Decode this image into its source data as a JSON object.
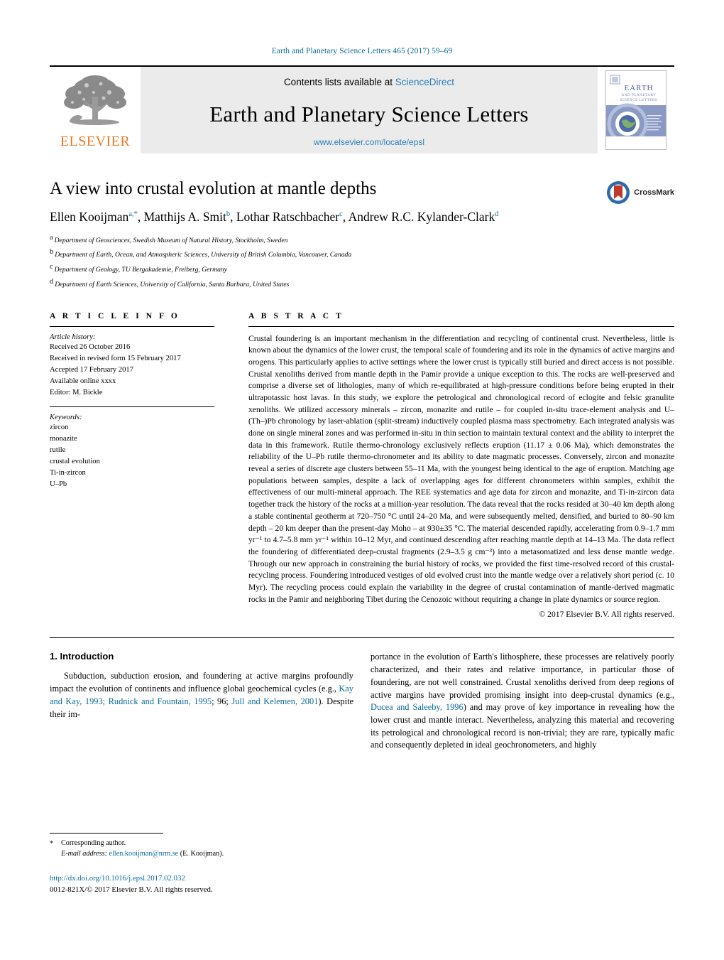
{
  "running_head": "Earth and Planetary Science Letters 465 (2017) 59–69",
  "masthead": {
    "publisher_name": "ELSEVIER",
    "contents_prefix": "Contents lists available at ",
    "contents_link": "ScienceDirect",
    "journal_title": "Earth and Planetary Science Letters",
    "journal_url": "www.elsevier.com/locate/epsl",
    "cover_title_line1": "EARTH",
    "cover_title_line2": "AND PLANETARY",
    "cover_title_line3": "SCIENCE LETTERS"
  },
  "article": {
    "title": "A view into crustal evolution at mantle depths",
    "crossmark_label": "CrossMark",
    "authors": [
      {
        "name": "Ellen Kooijman",
        "marks": "a,*"
      },
      {
        "name": "Matthijs A. Smit",
        "marks": "b"
      },
      {
        "name": "Lothar Ratschbacher",
        "marks": "c"
      },
      {
        "name": "Andrew R.C. Kylander-Clark",
        "marks": "d"
      }
    ],
    "affiliations": [
      {
        "mark": "a",
        "text": "Department of Geosciences, Swedish Museum of Natural History, Stockholm, Sweden"
      },
      {
        "mark": "b",
        "text": "Department of Earth, Ocean, and Atmospheric Sciences, University of British Columbia, Vancouver, Canada"
      },
      {
        "mark": "c",
        "text": "Department of Geology, TU Bergakademie, Freiberg, Germany"
      },
      {
        "mark": "d",
        "text": "Department of Earth Sciences, University of California, Santa Barbara, United States"
      }
    ]
  },
  "article_info": {
    "heading": "A R T I C L E   I N F O",
    "history_label": "Article history:",
    "history": [
      "Received 26 October 2016",
      "Received in revised form 15 February 2017",
      "Accepted 17 February 2017",
      "Available online xxxx",
      "Editor: M. Bickle"
    ],
    "keywords_label": "Keywords:",
    "keywords": [
      "zircon",
      "monazite",
      "rutile",
      "crustal evolution",
      "Ti-in-zircon",
      "U–Pb"
    ]
  },
  "abstract": {
    "heading": "A B S T R A C T",
    "text": "Crustal foundering is an important mechanism in the differentiation and recycling of continental crust. Nevertheless, little is known about the dynamics of the lower crust, the temporal scale of foundering and its role in the dynamics of active margins and orogens. This particularly applies to active settings where the lower crust is typically still buried and direct access is not possible. Crustal xenoliths derived from mantle depth in the Pamir provide a unique exception to this. The rocks are well-preserved and comprise a diverse set of lithologies, many of which re-equilibrated at high-pressure conditions before being erupted in their ultrapotassic host lavas. In this study, we explore the petrological and chronological record of eclogite and felsic granulite xenoliths. We utilized accessory minerals – zircon, monazite and rutile – for coupled in-situ trace-element analysis and U–(Th–)Pb chronology by laser-ablation (split-stream) inductively coupled plasma mass spectrometry. Each integrated analysis was done on single mineral zones and was performed in-situ in thin section to maintain textural context and the ability to interpret the data in this framework. Rutile thermo-chronology exclusively reflects eruption (11.17 ± 0.06 Ma), which demonstrates the reliability of the U–Pb rutile thermo-chronometer and its ability to date magmatic processes. Conversely, zircon and monazite reveal a series of discrete age clusters between 55–11 Ma, with the youngest being identical to the age of eruption. Matching age populations between samples, despite a lack of overlapping ages for different chronometers within samples, exhibit the effectiveness of our multi-mineral approach. The REE systematics and age data for zircon and monazite, and Ti-in-zircon data together track the history of the rocks at a million-year resolution. The data reveal that the rocks resided at 30–40 km depth along a stable continental geotherm at 720–750 °C until 24–20 Ma, and were subsequently melted, densified, and buried to 80–90 km depth – 20 km deeper than the present-day Moho – at 930±35 °C. The material descended rapidly, accelerating from 0.9–1.7 mm yr⁻¹ to 4.7–5.8 mm yr⁻¹ within 10–12 Myr, and continued descending after reaching mantle depth at 14–13 Ma. The data reflect the foundering of differentiated deep-crustal fragments (2.9–3.5 g cm⁻³) into a metasomatized and less dense mantle wedge. Through our new approach in constraining the burial history of rocks, we provided the first time-resolved record of this crustal-recycling process. Foundering introduced vestiges of old evolved crust into the mantle wedge over a relatively short period (c. 10 Myr). The recycling process could explain the variability in the degree of crustal contamination of mantle-derived magmatic rocks in the Pamir and neighboring Tibet during the Cenozoic without requiring a change in plate dynamics or source region.",
    "copyright": "© 2017 Elsevier B.V. All rights reserved."
  },
  "introduction": {
    "section_number_title": "1. Introduction",
    "left_paragraph_parts": [
      {
        "type": "text",
        "value": "Subduction, subduction erosion, and foundering at active margins profoundly impact the evolution of continents and influence global geochemical cycles (e.g., "
      },
      {
        "type": "cite",
        "value": "Kay and Kay, 1993; Rudnick and Fountain, 1995"
      },
      {
        "type": "text",
        "value": "; 96; "
      },
      {
        "type": "cite",
        "value": "Jull and Kelemen, 2001"
      },
      {
        "type": "text",
        "value": "). Despite their im-"
      }
    ],
    "right_paragraph_parts": [
      {
        "type": "text",
        "value": "portance in the evolution of Earth's lithosphere, these processes are relatively poorly characterized, and their rates and relative importance, in particular those of foundering, are not well constrained. Crustal xenoliths derived from deep regions of active margins have provided promising insight into deep-crustal dynamics (e.g., "
      },
      {
        "type": "cite",
        "value": "Ducea and Saleeby, 1996"
      },
      {
        "type": "text",
        "value": ") and may prove of key importance in revealing how the lower crust and mantle interact. Nevertheless, analyzing this material and recovering its petrological and chronological record is non-trivial; they are rare, typically mafic and consequently depleted in ideal geochronometers, and highly"
      }
    ]
  },
  "footer": {
    "corresponding_marker": "*",
    "corresponding_label": "Corresponding author.",
    "email_label": "E-mail address:",
    "email": "ellen.kooijman@nrm.se",
    "email_suffix": "(E. Kooijman).",
    "doi": "http://dx.doi.org/10.1016/j.epsl.2017.02.032",
    "issn_line": "0012-821X/© 2017 Elsevier B.V. All rights reserved."
  },
  "colors": {
    "link": "#0b6a9c",
    "elsevier_orange": "#e87722",
    "sciencedirect_blue": "#2a7fb8",
    "masthead_gray": "#ebebeb"
  }
}
